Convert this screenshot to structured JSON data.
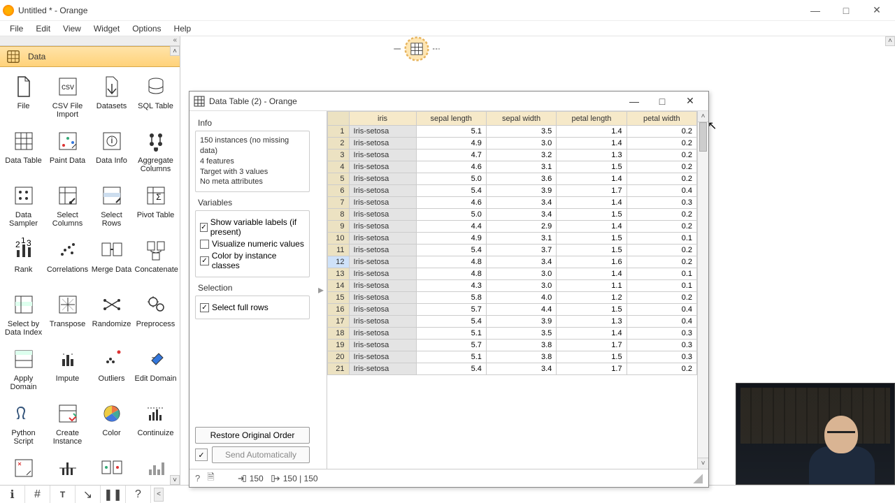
{
  "window": {
    "title": "Untitled * - Orange"
  },
  "menu": [
    "File",
    "Edit",
    "View",
    "Widget",
    "Options",
    "Help"
  ],
  "sidebar": {
    "category": "Data",
    "widgets": [
      {
        "label": "File"
      },
      {
        "label": "CSV File Import"
      },
      {
        "label": "Datasets"
      },
      {
        "label": "SQL Table"
      },
      {
        "label": "Data Table"
      },
      {
        "label": "Paint Data"
      },
      {
        "label": "Data Info"
      },
      {
        "label": "Aggregate Columns"
      },
      {
        "label": "Data Sampler"
      },
      {
        "label": "Select Columns"
      },
      {
        "label": "Select Rows"
      },
      {
        "label": "Pivot Table"
      },
      {
        "label": "Rank"
      },
      {
        "label": "Correlations"
      },
      {
        "label": "Merge Data"
      },
      {
        "label": "Concatenate"
      },
      {
        "label": "Select by Data Index"
      },
      {
        "label": "Transpose"
      },
      {
        "label": "Randomize"
      },
      {
        "label": "Preprocess"
      },
      {
        "label": "Apply Domain"
      },
      {
        "label": "Impute"
      },
      {
        "label": "Outliers"
      },
      {
        "label": "Edit Domain"
      },
      {
        "label": "Python Script"
      },
      {
        "label": "Create Instance"
      },
      {
        "label": "Color"
      },
      {
        "label": "Continuize"
      }
    ]
  },
  "dialog": {
    "title": "Data Table (2) - Orange",
    "info": {
      "heading": "Info",
      "line1": "150 instances (no missing data)",
      "line2": "4 features",
      "line3": "Target with 3 values",
      "line4": "No meta attributes"
    },
    "variables": {
      "heading": "Variables",
      "cb1": {
        "label": "Show variable labels (if present)",
        "checked": true
      },
      "cb2": {
        "label": "Visualize numeric values",
        "checked": false
      },
      "cb3": {
        "label": "Color by instance classes",
        "checked": true
      }
    },
    "selection": {
      "heading": "Selection",
      "cb1": {
        "label": "Select full rows",
        "checked": true
      }
    },
    "buttons": {
      "restore": "Restore Original Order",
      "send": "Send Automatically"
    },
    "status": {
      "in": "150",
      "out": "150 | 150"
    },
    "table": {
      "headers": [
        "iris",
        "sepal length",
        "sepal width",
        "petal length",
        "petal width"
      ],
      "rows": [
        {
          "i": 1,
          "c": "Iris-setosa",
          "v": [
            5.1,
            3.5,
            1.4,
            0.2
          ]
        },
        {
          "i": 2,
          "c": "Iris-setosa",
          "v": [
            4.9,
            3.0,
            1.4,
            0.2
          ]
        },
        {
          "i": 3,
          "c": "Iris-setosa",
          "v": [
            4.7,
            3.2,
            1.3,
            0.2
          ]
        },
        {
          "i": 4,
          "c": "Iris-setosa",
          "v": [
            4.6,
            3.1,
            1.5,
            0.2
          ]
        },
        {
          "i": 5,
          "c": "Iris-setosa",
          "v": [
            5.0,
            3.6,
            1.4,
            0.2
          ]
        },
        {
          "i": 6,
          "c": "Iris-setosa",
          "v": [
            5.4,
            3.9,
            1.7,
            0.4
          ]
        },
        {
          "i": 7,
          "c": "Iris-setosa",
          "v": [
            4.6,
            3.4,
            1.4,
            0.3
          ]
        },
        {
          "i": 8,
          "c": "Iris-setosa",
          "v": [
            5.0,
            3.4,
            1.5,
            0.2
          ]
        },
        {
          "i": 9,
          "c": "Iris-setosa",
          "v": [
            4.4,
            2.9,
            1.4,
            0.2
          ]
        },
        {
          "i": 10,
          "c": "Iris-setosa",
          "v": [
            4.9,
            3.1,
            1.5,
            0.1
          ]
        },
        {
          "i": 11,
          "c": "Iris-setosa",
          "v": [
            5.4,
            3.7,
            1.5,
            0.2
          ]
        },
        {
          "i": 12,
          "c": "Iris-setosa",
          "v": [
            4.8,
            3.4,
            1.6,
            0.2
          ]
        },
        {
          "i": 13,
          "c": "Iris-setosa",
          "v": [
            4.8,
            3.0,
            1.4,
            0.1
          ]
        },
        {
          "i": 14,
          "c": "Iris-setosa",
          "v": [
            4.3,
            3.0,
            1.1,
            0.1
          ]
        },
        {
          "i": 15,
          "c": "Iris-setosa",
          "v": [
            5.8,
            4.0,
            1.2,
            0.2
          ]
        },
        {
          "i": 16,
          "c": "Iris-setosa",
          "v": [
            5.7,
            4.4,
            1.5,
            0.4
          ]
        },
        {
          "i": 17,
          "c": "Iris-setosa",
          "v": [
            5.4,
            3.9,
            1.3,
            0.4
          ]
        },
        {
          "i": 18,
          "c": "Iris-setosa",
          "v": [
            5.1,
            3.5,
            1.4,
            0.3
          ]
        },
        {
          "i": 19,
          "c": "Iris-setosa",
          "v": [
            5.7,
            3.8,
            1.7,
            0.3
          ]
        },
        {
          "i": 20,
          "c": "Iris-setosa",
          "v": [
            5.1,
            3.8,
            1.5,
            0.3
          ]
        },
        {
          "i": 21,
          "c": "Iris-setosa",
          "v": [
            5.4,
            3.4,
            1.7,
            0.2
          ]
        }
      ],
      "selected_row": 12
    }
  }
}
